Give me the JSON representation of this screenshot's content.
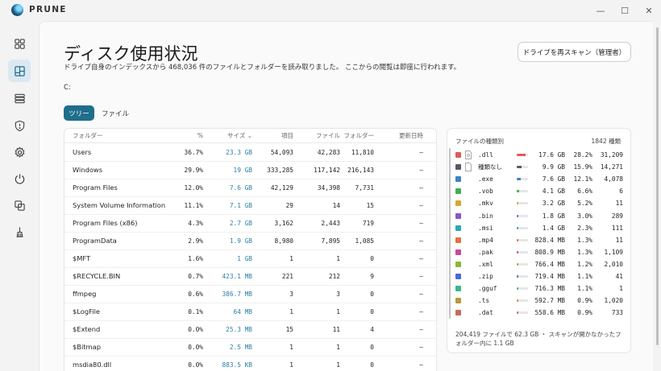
{
  "app": {
    "title": "PRUNE"
  },
  "window_controls": {
    "minimize": "—",
    "maximize": "☐",
    "close": "✕"
  },
  "sidebar": {
    "items": [
      {
        "name": "overview",
        "icon": "grid-icon"
      },
      {
        "name": "disk-usage",
        "icon": "treemap-icon",
        "active": true
      },
      {
        "name": "storage",
        "icon": "database-icon"
      },
      {
        "name": "security",
        "icon": "shield-icon"
      },
      {
        "name": "settings",
        "icon": "gear-icon"
      },
      {
        "name": "power",
        "icon": "power-icon"
      },
      {
        "name": "duplicates",
        "icon": "copy-icon"
      },
      {
        "name": "cleanup",
        "icon": "broom-icon"
      }
    ]
  },
  "header": {
    "title": "ディスク使用状況",
    "subtitle": "ドライブ自身のインデックスから 468,036 件のファイルとフォルダーを読み取りました。 ここからの閲覧は即座に行われます。",
    "drive": "C:",
    "rescan_label": "ドライブを再スキャン（管理者）"
  },
  "tabs": [
    {
      "label": "ツリー",
      "active": true
    },
    {
      "label": "ファイル"
    }
  ],
  "table": {
    "columns": {
      "folder": "フォルダー",
      "pct": "%",
      "size": "サイズ ⌄",
      "items": "項目",
      "files": "ファイル",
      "folders": "フォルダー",
      "modified": "更新日時"
    },
    "rows": [
      {
        "name": "Users",
        "pct": "36.7%",
        "size": "23.3 GB",
        "items": "54,093",
        "files": "42,283",
        "folders": "11,810",
        "modified": "—"
      },
      {
        "name": "Windows",
        "pct": "29.9%",
        "size": "19 GB",
        "items": "333,285",
        "files": "117,142",
        "folders": "216,143",
        "modified": "—"
      },
      {
        "name": "Program Files",
        "pct": "12.0%",
        "size": "7.6 GB",
        "items": "42,129",
        "files": "34,398",
        "folders": "7,731",
        "modified": "—"
      },
      {
        "name": "System Volume Information",
        "pct": "11.1%",
        "size": "7.1 GB",
        "items": "29",
        "files": "14",
        "folders": "15",
        "modified": "—"
      },
      {
        "name": "Program Files (x86)",
        "pct": "4.3%",
        "size": "2.7 GB",
        "items": "3,162",
        "files": "2,443",
        "folders": "719",
        "modified": "—"
      },
      {
        "name": "ProgramData",
        "pct": "2.9%",
        "size": "1.9 GB",
        "items": "8,980",
        "files": "7,895",
        "folders": "1,085",
        "modified": "—"
      },
      {
        "name": "$MFT",
        "pct": "1.6%",
        "size": "1 GB",
        "items": "1",
        "files": "1",
        "folders": "0",
        "modified": "—"
      },
      {
        "name": "$RECYCLE.BIN",
        "pct": "0.7%",
        "size": "423.1 MB",
        "items": "221",
        "files": "212",
        "folders": "9",
        "modified": "—"
      },
      {
        "name": "ffmpeg",
        "pct": "0.6%",
        "size": "386.7 MB",
        "items": "3",
        "files": "3",
        "folders": "0",
        "modified": "—"
      },
      {
        "name": "$LogFile",
        "pct": "0.1%",
        "size": "64 MB",
        "items": "1",
        "files": "1",
        "folders": "0",
        "modified": "—"
      },
      {
        "name": "$Extend",
        "pct": "0.0%",
        "size": "25.3 MB",
        "items": "15",
        "files": "11",
        "folders": "4",
        "modified": "—"
      },
      {
        "name": "$Bitmap",
        "pct": "0.0%",
        "size": "2.5 MB",
        "items": "1",
        "files": "1",
        "folders": "0",
        "modified": "—"
      },
      {
        "name": "msdia80.dll",
        "pct": "0.0%",
        "size": "883.5 KB",
        "items": "1",
        "files": "1",
        "folders": "0",
        "modified": "—"
      }
    ]
  },
  "file_types": {
    "heading": "ファイルの種類別",
    "count": "1842 種類",
    "rows": [
      {
        "ext": ".dll",
        "color": "#e05a5a",
        "fill": 0.282,
        "size": "17.6 GB",
        "pct": "28.2%",
        "count": "31,209",
        "icon": "file-gear-icon"
      },
      {
        "ext": "種類なし",
        "color": "#555a66",
        "fill": 0.159,
        "size": "9.9 GB",
        "pct": "15.9%",
        "count": "14,271",
        "icon": "file-icon"
      },
      {
        "ext": ".exe",
        "color": "#3b82c8",
        "fill": 0.121,
        "size": "7.6 GB",
        "pct": "12.1%",
        "count": "4,078"
      },
      {
        "ext": ".vob",
        "color": "#3fae5a",
        "fill": 0.066,
        "size": "4.1 GB",
        "pct": "6.6%",
        "count": "6"
      },
      {
        "ext": ".mkv",
        "color": "#d9a830",
        "fill": 0.052,
        "size": "3.2 GB",
        "pct": "5.2%",
        "count": "11"
      },
      {
        "ext": ".bin",
        "color": "#8a56c8",
        "fill": 0.03,
        "size": "1.8 GB",
        "pct": "3.0%",
        "count": "289"
      },
      {
        "ext": ".msi",
        "color": "#2aa8b8",
        "fill": 0.023,
        "size": "1.4 GB",
        "pct": "2.3%",
        "count": "111"
      },
      {
        "ext": ".mp4",
        "color": "#e0743a",
        "fill": 0.013,
        "size": "828.4 MB",
        "pct": "1.3%",
        "count": "11"
      },
      {
        "ext": ".pak",
        "color": "#c84a9a",
        "fill": 0.013,
        "size": "808.9 MB",
        "pct": "1.3%",
        "count": "1,109"
      },
      {
        "ext": ".xml",
        "color": "#8ab83a",
        "fill": 0.012,
        "size": "766.4 MB",
        "pct": "1.2%",
        "count": "2,010"
      },
      {
        "ext": ".zip",
        "color": "#4a6ad8",
        "fill": 0.011,
        "size": "719.4 MB",
        "pct": "1.1%",
        "count": "41"
      },
      {
        "ext": ".gguf",
        "color": "#3ab88a",
        "fill": 0.011,
        "size": "716.3 MB",
        "pct": "1.1%",
        "count": "1"
      },
      {
        "ext": ".ts",
        "color": "#b89a3a",
        "fill": 0.009,
        "size": "592.7 MB",
        "pct": "0.9%",
        "count": "1,020"
      },
      {
        "ext": ".dat",
        "color": "#c86a5a",
        "fill": 0.009,
        "size": "558.6 MB",
        "pct": "0.9%",
        "count": "733"
      }
    ],
    "footer": "204,419 ファイルで 62.3 GB ・ スキャンが開かなかったフォルダー内に 1.1 GB"
  }
}
